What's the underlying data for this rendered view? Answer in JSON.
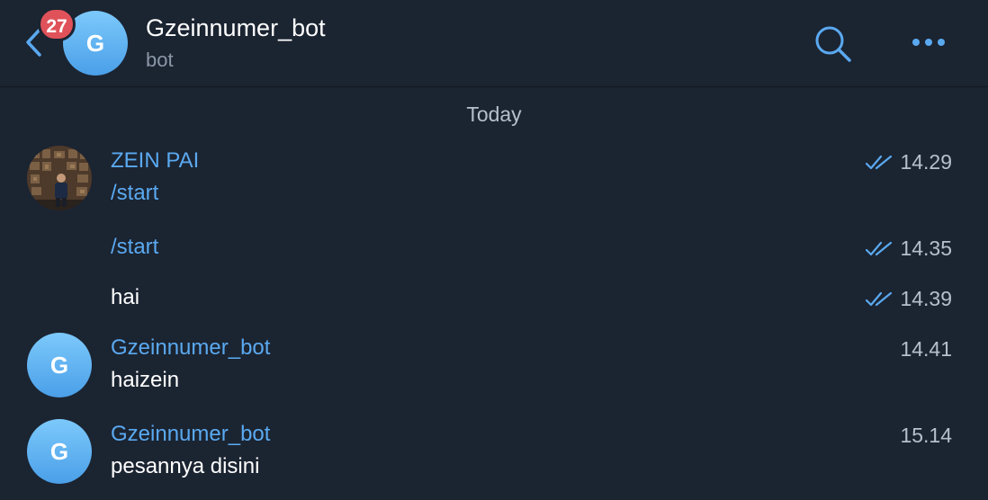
{
  "header": {
    "unread_count": "27",
    "avatar_letter": "G",
    "title": "Gzeinnumer_bot",
    "subtitle": "bot"
  },
  "date_separator": "Today",
  "messages": [
    {
      "sender": "ZEIN PAI",
      "text": "/start",
      "time": "14.29",
      "read": true,
      "is_command": true
    },
    {
      "sender": "",
      "text": "/start",
      "time": "14.35",
      "read": true,
      "is_command": true
    },
    {
      "sender": "",
      "text": "hai",
      "time": "14.39",
      "read": true,
      "is_command": false
    },
    {
      "sender": "Gzeinnumer_bot",
      "avatar_letter": "G",
      "text": "haizein",
      "time": "14.41",
      "read": false,
      "is_command": false
    },
    {
      "sender": "Gzeinnumer_bot",
      "avatar_letter": "G",
      "text": "pesannya disini",
      "time": "15.14",
      "read": false,
      "is_command": false
    }
  ],
  "colors": {
    "background": "#1b2431",
    "accent": "#5aa9f0",
    "badge": "#e0525a",
    "muted": "#8b98a8"
  },
  "icons": {
    "back": "chevron-left-icon",
    "search": "search-icon",
    "more": "more-horizontal-icon",
    "read": "double-check-icon"
  }
}
